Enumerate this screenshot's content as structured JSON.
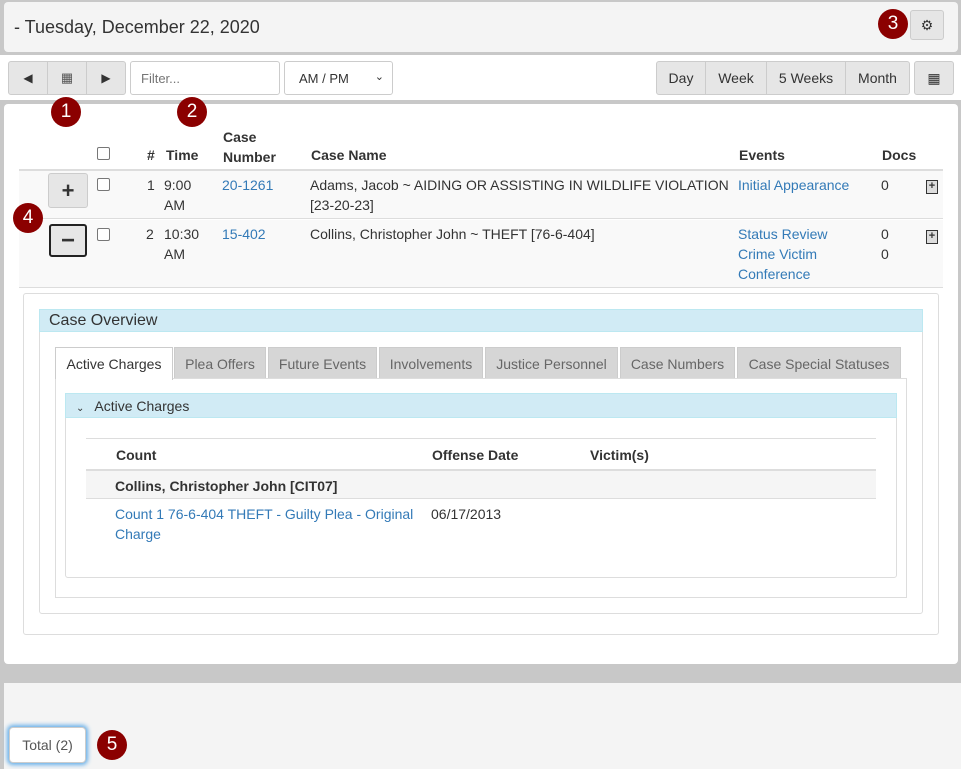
{
  "header": {
    "title": "- Tuesday, December 22, 2020",
    "settings_icon": "gear-icon"
  },
  "toolbar": {
    "prev_icon": "triangle-left-icon",
    "calendar_icon": "calendar-icon",
    "next_icon": "triangle-right-icon",
    "filter_placeholder": "Filter...",
    "ampm_value": "AM / PM",
    "views": [
      "Day",
      "Week",
      "5 Weeks",
      "Month"
    ],
    "layout_icon": "layout-grid-icon"
  },
  "callouts": [
    "1",
    "2",
    "3",
    "4",
    "5"
  ],
  "table": {
    "headers": {
      "num": "#",
      "time": "Time",
      "case_number": "Case Number",
      "case_name": "Case Name",
      "events": "Events",
      "docs": "Docs"
    },
    "rows": [
      {
        "num": "1",
        "time": "9:00 AM",
        "case_number": "20-1261",
        "case_name": "Adams, Jacob ~ AIDING OR ASSISTING IN WILDLIFE VIOLATION [23-20-23]",
        "events": [
          "Initial Appearance"
        ],
        "docs": [
          "0"
        ],
        "expanded": false
      },
      {
        "num": "2",
        "time": "10:30 AM",
        "case_number": "15-402",
        "case_name": "Collins, Christopher John ~ THEFT [76-6-404]",
        "events": [
          "Status Review",
          "Crime Victim Conference"
        ],
        "docs": [
          "0",
          "0"
        ],
        "expanded": true
      }
    ]
  },
  "overview": {
    "title": "Case Overview",
    "tabs": [
      "Active Charges",
      "Plea Offers",
      "Future Events",
      "Involvements",
      "Justice Personnel",
      "Case Numbers",
      "Case Special Statuses"
    ],
    "active_tab": "Active Charges",
    "section_title": "Active Charges",
    "charges_headers": {
      "count": "Count",
      "offense_date": "Offense Date",
      "victims": "Victim(s)"
    },
    "group": "Collins, Christopher John [CIT07]",
    "charge": {
      "count": "Count 1 76-6-404 THEFT - Guilty Plea - Original Charge",
      "offense_date": "06/17/2013",
      "victims": ""
    }
  },
  "footer": {
    "total": "Total (2)"
  },
  "colors": {
    "link": "#337ab7",
    "callout": "#8b0000",
    "panel_header": "#d1ebf5"
  }
}
